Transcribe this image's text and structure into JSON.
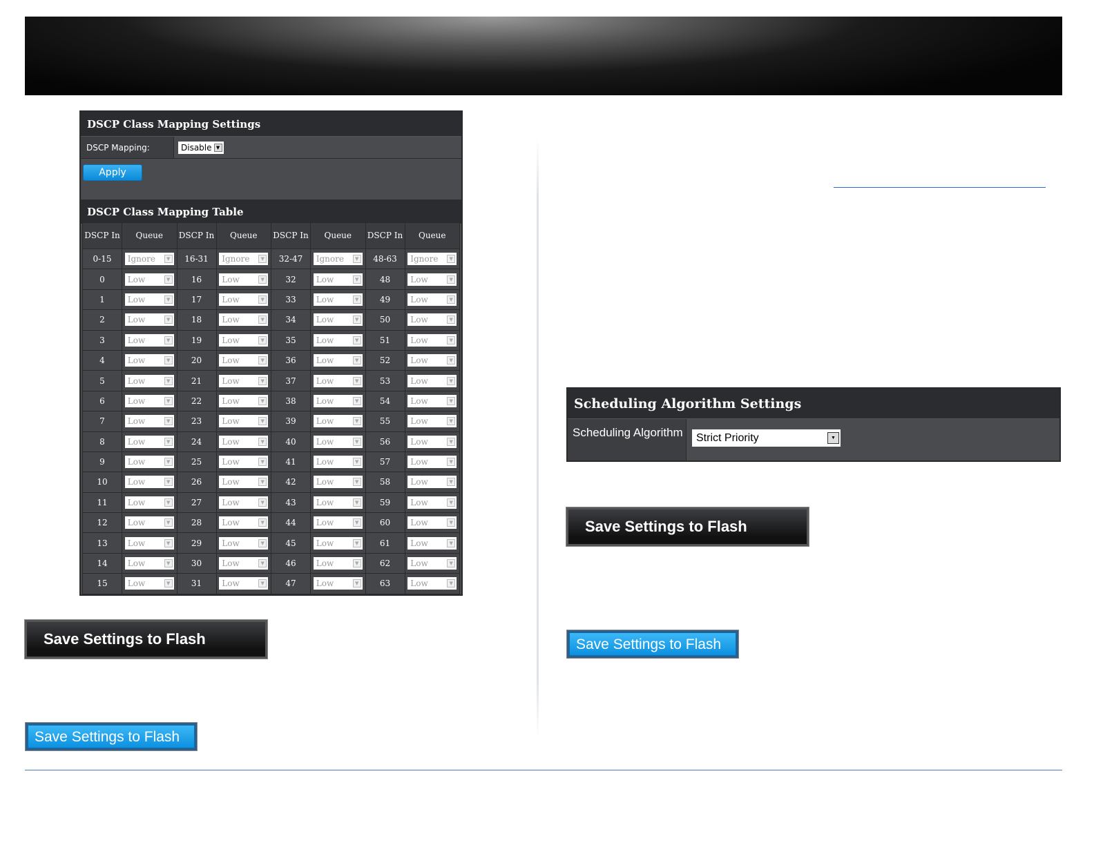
{
  "dscp_settings": {
    "title": "DSCP Class Mapping Settings",
    "mapping_label": "DSCP Mapping:",
    "mapping_value": "Disable",
    "apply_label": "Apply"
  },
  "dscp_table": {
    "title": "DSCP Class Mapping Table",
    "col_dscp": "DSCP In",
    "col_queue": "Queue",
    "range_row": [
      [
        "0-15",
        "Ignore"
      ],
      [
        "16-31",
        "Ignore"
      ],
      [
        "32-47",
        "Ignore"
      ],
      [
        "48-63",
        "Ignore"
      ]
    ],
    "default_queue": "Low",
    "rows": [
      [
        "0",
        "16",
        "32",
        "48"
      ],
      [
        "1",
        "17",
        "33",
        "49"
      ],
      [
        "2",
        "18",
        "34",
        "50"
      ],
      [
        "3",
        "19",
        "35",
        "51"
      ],
      [
        "4",
        "20",
        "36",
        "52"
      ],
      [
        "5",
        "21",
        "37",
        "53"
      ],
      [
        "6",
        "22",
        "38",
        "54"
      ],
      [
        "7",
        "23",
        "39",
        "55"
      ],
      [
        "8",
        "24",
        "40",
        "56"
      ],
      [
        "9",
        "25",
        "41",
        "57"
      ],
      [
        "10",
        "26",
        "42",
        "58"
      ],
      [
        "11",
        "27",
        "43",
        "59"
      ],
      [
        "12",
        "28",
        "44",
        "60"
      ],
      [
        "13",
        "29",
        "45",
        "61"
      ],
      [
        "14",
        "30",
        "46",
        "62"
      ],
      [
        "15",
        "31",
        "47",
        "63"
      ]
    ]
  },
  "scheduling": {
    "title": "Scheduling Algorithm Settings",
    "label": "Scheduling Algorithm",
    "value": "Strict Priority"
  },
  "save_flash_dark_left": "Save Settings to Flash",
  "save_flash_blue_left": "Save Settings to Flash",
  "save_flash_dark_right": "Save Settings to Flash",
  "save_flash_blue_right": "Save Settings to Flash"
}
